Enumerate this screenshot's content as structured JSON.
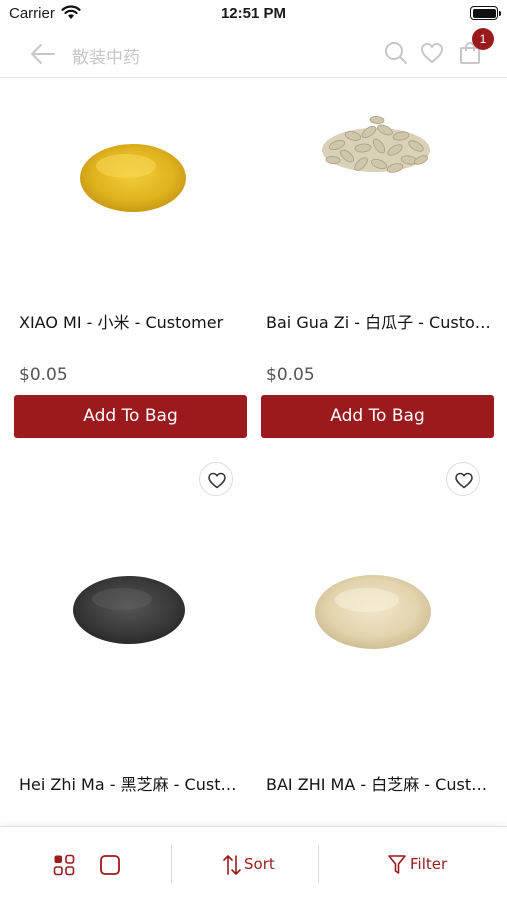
{
  "status_bar": {
    "carrier": "Carrier",
    "time": "12:51 PM"
  },
  "nav": {
    "title": "散装中药",
    "bag_count": "1"
  },
  "products": [
    {
      "name": "XIAO MI - 小米 - Customer",
      "price": "$0.05",
      "button": "Add To Bag",
      "image": "yellow-millet-pile"
    },
    {
      "name": "Bai Gua Zi - 白瓜子 - Customer",
      "price": "$0.05",
      "button": "Add To Bag",
      "image": "pumpkin-seed-pile"
    },
    {
      "name": "Hei Zhi Ma - 黑芝麻 - Customer",
      "price": "",
      "button": "",
      "image": "black-sesame-pile"
    },
    {
      "name": "BAI ZHI MA - 白芝麻 - Customer",
      "price": "",
      "button": "",
      "image": "white-sesame-pile"
    }
  ],
  "bottom_bar": {
    "sort_label": "Sort",
    "filter_label": "Filter"
  },
  "colors": {
    "accent": "#9b1a1d",
    "price_text": "#555555",
    "nav_title": "#c7c7c7"
  }
}
